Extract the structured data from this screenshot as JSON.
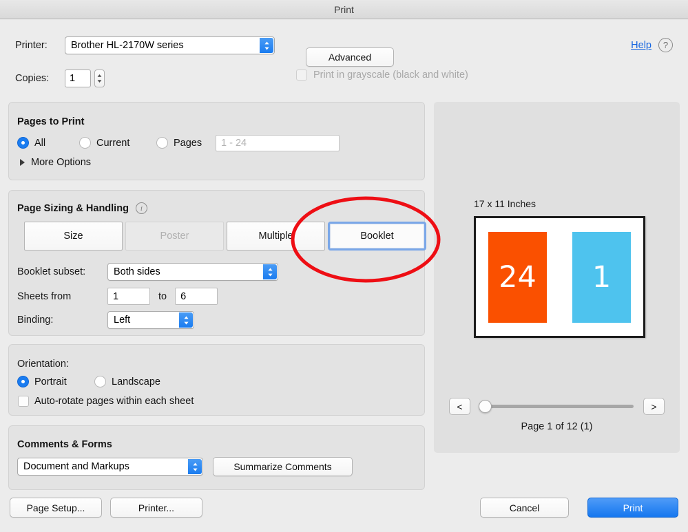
{
  "window": {
    "title": "Print"
  },
  "top": {
    "printer_label": "Printer:",
    "printer_value": "Brother HL-2170W series",
    "advanced_label": "Advanced",
    "help_label": "Help",
    "help_icon": "question-mark-circle-icon",
    "copies_label": "Copies:",
    "copies_value": "1",
    "grayscale_label": "Print in grayscale (black and white)",
    "grayscale_checked": "false"
  },
  "pages_to_print": {
    "title": "Pages to Print",
    "options": [
      {
        "label": "All",
        "selected": "true"
      },
      {
        "label": "Current",
        "selected": "false"
      },
      {
        "label": "Pages",
        "selected": "false"
      }
    ],
    "pages_placeholder": "1 - 24",
    "more_options_label": "More Options"
  },
  "page_sizing": {
    "title": "Page Sizing & Handling",
    "info_icon": "info-circle-icon",
    "modes": [
      {
        "label": "Size",
        "state": "normal"
      },
      {
        "label": "Poster",
        "state": "disabled"
      },
      {
        "label": "Multiple",
        "state": "normal"
      },
      {
        "label": "Booklet",
        "state": "selected"
      }
    ],
    "subset_label": "Booklet subset:",
    "subset_value": "Both sides",
    "sheets_from_label": "Sheets from",
    "sheets_from_value": "1",
    "sheets_to_label": "to",
    "sheets_to_value": "6",
    "binding_label": "Binding:",
    "binding_value": "Left"
  },
  "orientation": {
    "title": "Orientation:",
    "options": [
      {
        "label": "Portrait",
        "selected": "true"
      },
      {
        "label": "Landscape",
        "selected": "false"
      }
    ],
    "autorotate_label": "Auto-rotate pages within each sheet",
    "autorotate_checked": "false"
  },
  "comments": {
    "title": "Comments & Forms",
    "select_value": "Document and Markups",
    "summarize_label": "Summarize Comments"
  },
  "preview": {
    "paper_size": "17 x 11 Inches",
    "left_page_number": "24",
    "right_page_number": "1",
    "left_page_color": "#FA5000",
    "right_page_color": "#4EC3EE",
    "prev_label": "<",
    "next_label": ">",
    "page_indicator": "Page 1 of 12 (1)",
    "slider_position_percent": 0
  },
  "footer": {
    "page_setup_label": "Page Setup...",
    "printer_label": "Printer...",
    "cancel_label": "Cancel",
    "print_label": "Print"
  },
  "annotation": {
    "shape": "red-ellipse-highlight",
    "color": "#EE0E14",
    "target": "Booklet"
  }
}
